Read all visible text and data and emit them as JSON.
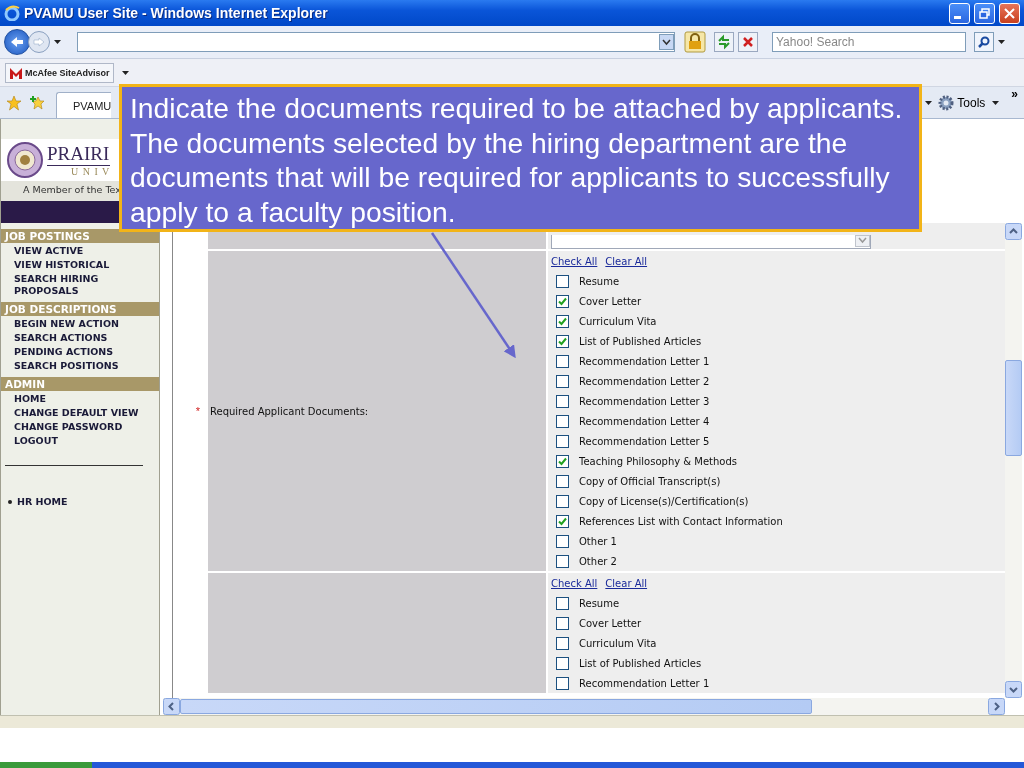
{
  "window": {
    "title": "PVAMU User Site - Windows Internet Explorer"
  },
  "search": {
    "placeholder": "Yahoo! Search"
  },
  "links_bar": {
    "siteadvisor": "McAfee SiteAdvisor"
  },
  "tabs": [
    {
      "label": "PVAMU",
      "selected": true
    }
  ],
  "command_bar": {
    "tools": "Tools",
    "more": "»"
  },
  "logo": {
    "name": "PRAIRI",
    "subtitle": "U N I V",
    "tagline": "A Member of the Tex"
  },
  "sidebar": {
    "sections": [
      {
        "title": "JOB POSTINGS",
        "items": [
          "VIEW ACTIVE",
          "VIEW HISTORICAL",
          "SEARCH HIRING PROPOSALS"
        ]
      },
      {
        "title": "JOB DESCRIPTIONS",
        "items": [
          "BEGIN NEW ACTION",
          "SEARCH ACTIONS",
          "PENDING ACTIONS",
          "SEARCH POSITIONS"
        ]
      },
      {
        "title": "ADMIN",
        "items": [
          "HOME",
          "CHANGE DEFAULT VIEW",
          "CHANGE PASSWORD",
          "LOGOUT"
        ]
      }
    ],
    "links": [
      "HR HOME"
    ]
  },
  "form": {
    "rows": [
      {
        "required_mark": "*",
        "label": "Required Applicant Documents:",
        "check_all": "Check All",
        "clear_all": "Clear All",
        "options": [
          {
            "label": "Resume",
            "checked": false
          },
          {
            "label": "Cover Letter",
            "checked": true
          },
          {
            "label": "Curriculum Vita",
            "checked": true
          },
          {
            "label": "List of Published Articles",
            "checked": true
          },
          {
            "label": "Recommendation Letter 1",
            "checked": false
          },
          {
            "label": "Recommendation Letter 2",
            "checked": false
          },
          {
            "label": "Recommendation Letter 3",
            "checked": false
          },
          {
            "label": "Recommendation Letter 4",
            "checked": false
          },
          {
            "label": "Recommendation Letter 5",
            "checked": false
          },
          {
            "label": "Teaching Philosophy & Methods",
            "checked": true
          },
          {
            "label": "Copy of Official Transcript(s)",
            "checked": false
          },
          {
            "label": "Copy of License(s)/Certification(s)",
            "checked": false
          },
          {
            "label": "References List with Contact Information",
            "checked": true
          },
          {
            "label": "Other 1",
            "checked": false
          },
          {
            "label": "Other 2",
            "checked": false
          }
        ]
      },
      {
        "check_all": "Check All",
        "clear_all": "Clear All",
        "options": [
          {
            "label": "Resume",
            "checked": false
          },
          {
            "label": "Cover Letter",
            "checked": false
          },
          {
            "label": "Curriculum Vita",
            "checked": false
          },
          {
            "label": "List of Published Articles",
            "checked": false
          },
          {
            "label": "Recommendation Letter 1",
            "checked": false
          }
        ]
      }
    ]
  },
  "callout": {
    "text": "Indicate the documents required to be attached by applicants. The documents selected by the hiring department are the documents that will be required for applicants to successfully apply to a faculty position."
  }
}
